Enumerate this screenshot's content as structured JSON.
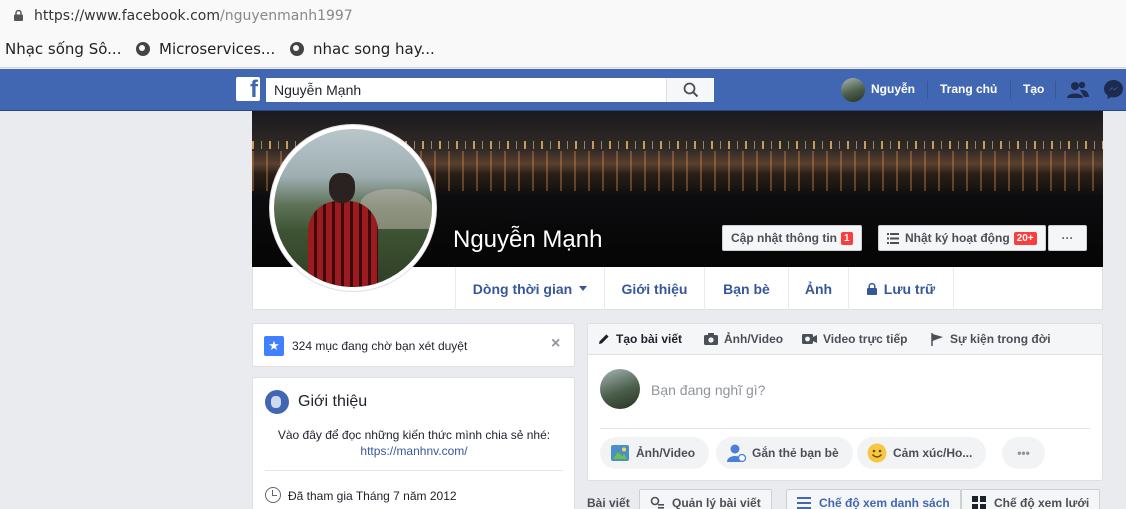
{
  "browser": {
    "url_host": "https://www.facebook.com",
    "url_path": "/nguyenmanh1997",
    "bookmarks": [
      {
        "label": "Nhạc sống Sô..."
      },
      {
        "label": "Microservices..."
      },
      {
        "label": "nhac song hay..."
      }
    ]
  },
  "fb_header": {
    "logo": "f",
    "search_value": "Nguyễn Mạnh",
    "user_name": "Nguyễn",
    "home": "Trang chủ",
    "create": "Tạo"
  },
  "profile": {
    "name": "Nguyễn Mạnh",
    "update_info": "Cập nhật thông tin",
    "update_badge": "1",
    "activity_log": "Nhật ký hoạt động",
    "activity_badge": "20+",
    "more": "···"
  },
  "tabs": {
    "timeline": "Dòng thời gian",
    "about": "Giới thiệu",
    "friends": "Bạn bè",
    "photos": "Ảnh",
    "archive": "Lưu trữ"
  },
  "review": {
    "text": "324 mục đang chờ bạn xét duyệt",
    "close": "×"
  },
  "intro": {
    "title": "Giới thiệu",
    "bio": "Vào đây để đọc những kiến thức mình chia sẻ nhé:",
    "link": "https://manhnv.com/",
    "joined": "Đã tham gia Tháng 7 năm 2012"
  },
  "composer": {
    "tabs": [
      "Tạo bài viết",
      "Ảnh/Video",
      "Video trực tiếp",
      "Sự kiện trong đời"
    ],
    "placeholder": "Bạn đang nghĩ gì?",
    "actions": [
      "Ảnh/Video",
      "Gắn thẻ bạn bè",
      "Cảm xúc/Ho...",
      "•••"
    ]
  },
  "posts_bar": {
    "label": "Bài viết",
    "manage": "Quản lý bài viết",
    "list_view": "Chế độ xem danh sách",
    "grid_view": "Chế độ xem lưới"
  },
  "colors": {
    "fb_blue": "#4267b2",
    "link_blue": "#365899",
    "badge_red": "#fa3e3e"
  }
}
